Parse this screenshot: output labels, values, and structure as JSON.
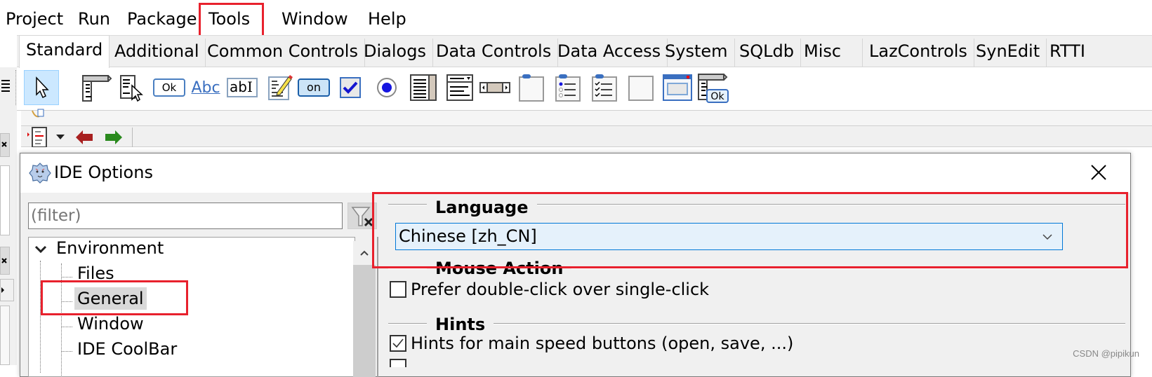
{
  "menubar": {
    "items": [
      "Project",
      "Run",
      "Package",
      "Tools",
      "Window",
      "Help"
    ],
    "highlighted": "Tools"
  },
  "palette": {
    "tabs": [
      "Standard",
      "Additional",
      "Common Controls",
      "Dialogs",
      "Data Controls",
      "Data Access",
      "System",
      "SQLdb",
      "Misc",
      "LazControls",
      "SynEdit",
      "RTTI"
    ],
    "active_tab": "Standard",
    "components": [
      {
        "name": "selection-pointer-icon",
        "label": ""
      },
      {
        "name": "tmainmenu-icon",
        "label": ""
      },
      {
        "name": "tpopupmenu-icon",
        "label": ""
      },
      {
        "name": "tbutton-icon",
        "label": "Ok"
      },
      {
        "name": "tlabel-icon",
        "label": "Abc"
      },
      {
        "name": "tedit-icon",
        "label": "ab"
      },
      {
        "name": "tmemo-icon",
        "label": ""
      },
      {
        "name": "ttogglebox-icon",
        "label": "on"
      },
      {
        "name": "tcheckbox-icon",
        "label": ""
      },
      {
        "name": "tradiobutton-icon",
        "label": ""
      },
      {
        "name": "tlistbox-icon",
        "label": ""
      },
      {
        "name": "tcombobox-icon",
        "label": ""
      },
      {
        "name": "tscrollbar-icon",
        "label": ""
      },
      {
        "name": "tgroupbox-icon",
        "label": ""
      },
      {
        "name": "tradiogroup-icon",
        "label": ""
      },
      {
        "name": "tcheckgroup-icon",
        "label": ""
      },
      {
        "name": "tpanel-icon",
        "label": ""
      },
      {
        "name": "tframe-icon",
        "label": ""
      },
      {
        "name": "tactionlist-icon",
        "label": "Ok"
      }
    ]
  },
  "dialog": {
    "title": "IDE Options",
    "filter_placeholder": "(filter)",
    "tree": {
      "root": "Environment",
      "children": [
        "Files",
        "General",
        "Window",
        "IDE CoolBar"
      ],
      "selected": "General"
    },
    "language": {
      "group_title": "Language",
      "value": "Chinese [zh_CN]"
    },
    "mouse_action": {
      "group_title": "Mouse Action",
      "checkbox_label": "Prefer double-click over single-click",
      "checked": false
    },
    "hints": {
      "group_title": "Hints",
      "checkbox_label": "Hints for main speed buttons (open, save, ...)",
      "checked": true
    }
  },
  "watermark": "CSDN @pipikun",
  "colors": {
    "highlight_red": "#e8212d",
    "combo_bg": "#e5f1fb",
    "combo_border": "#0078d7",
    "selected_component_bg": "#cce8ff"
  }
}
